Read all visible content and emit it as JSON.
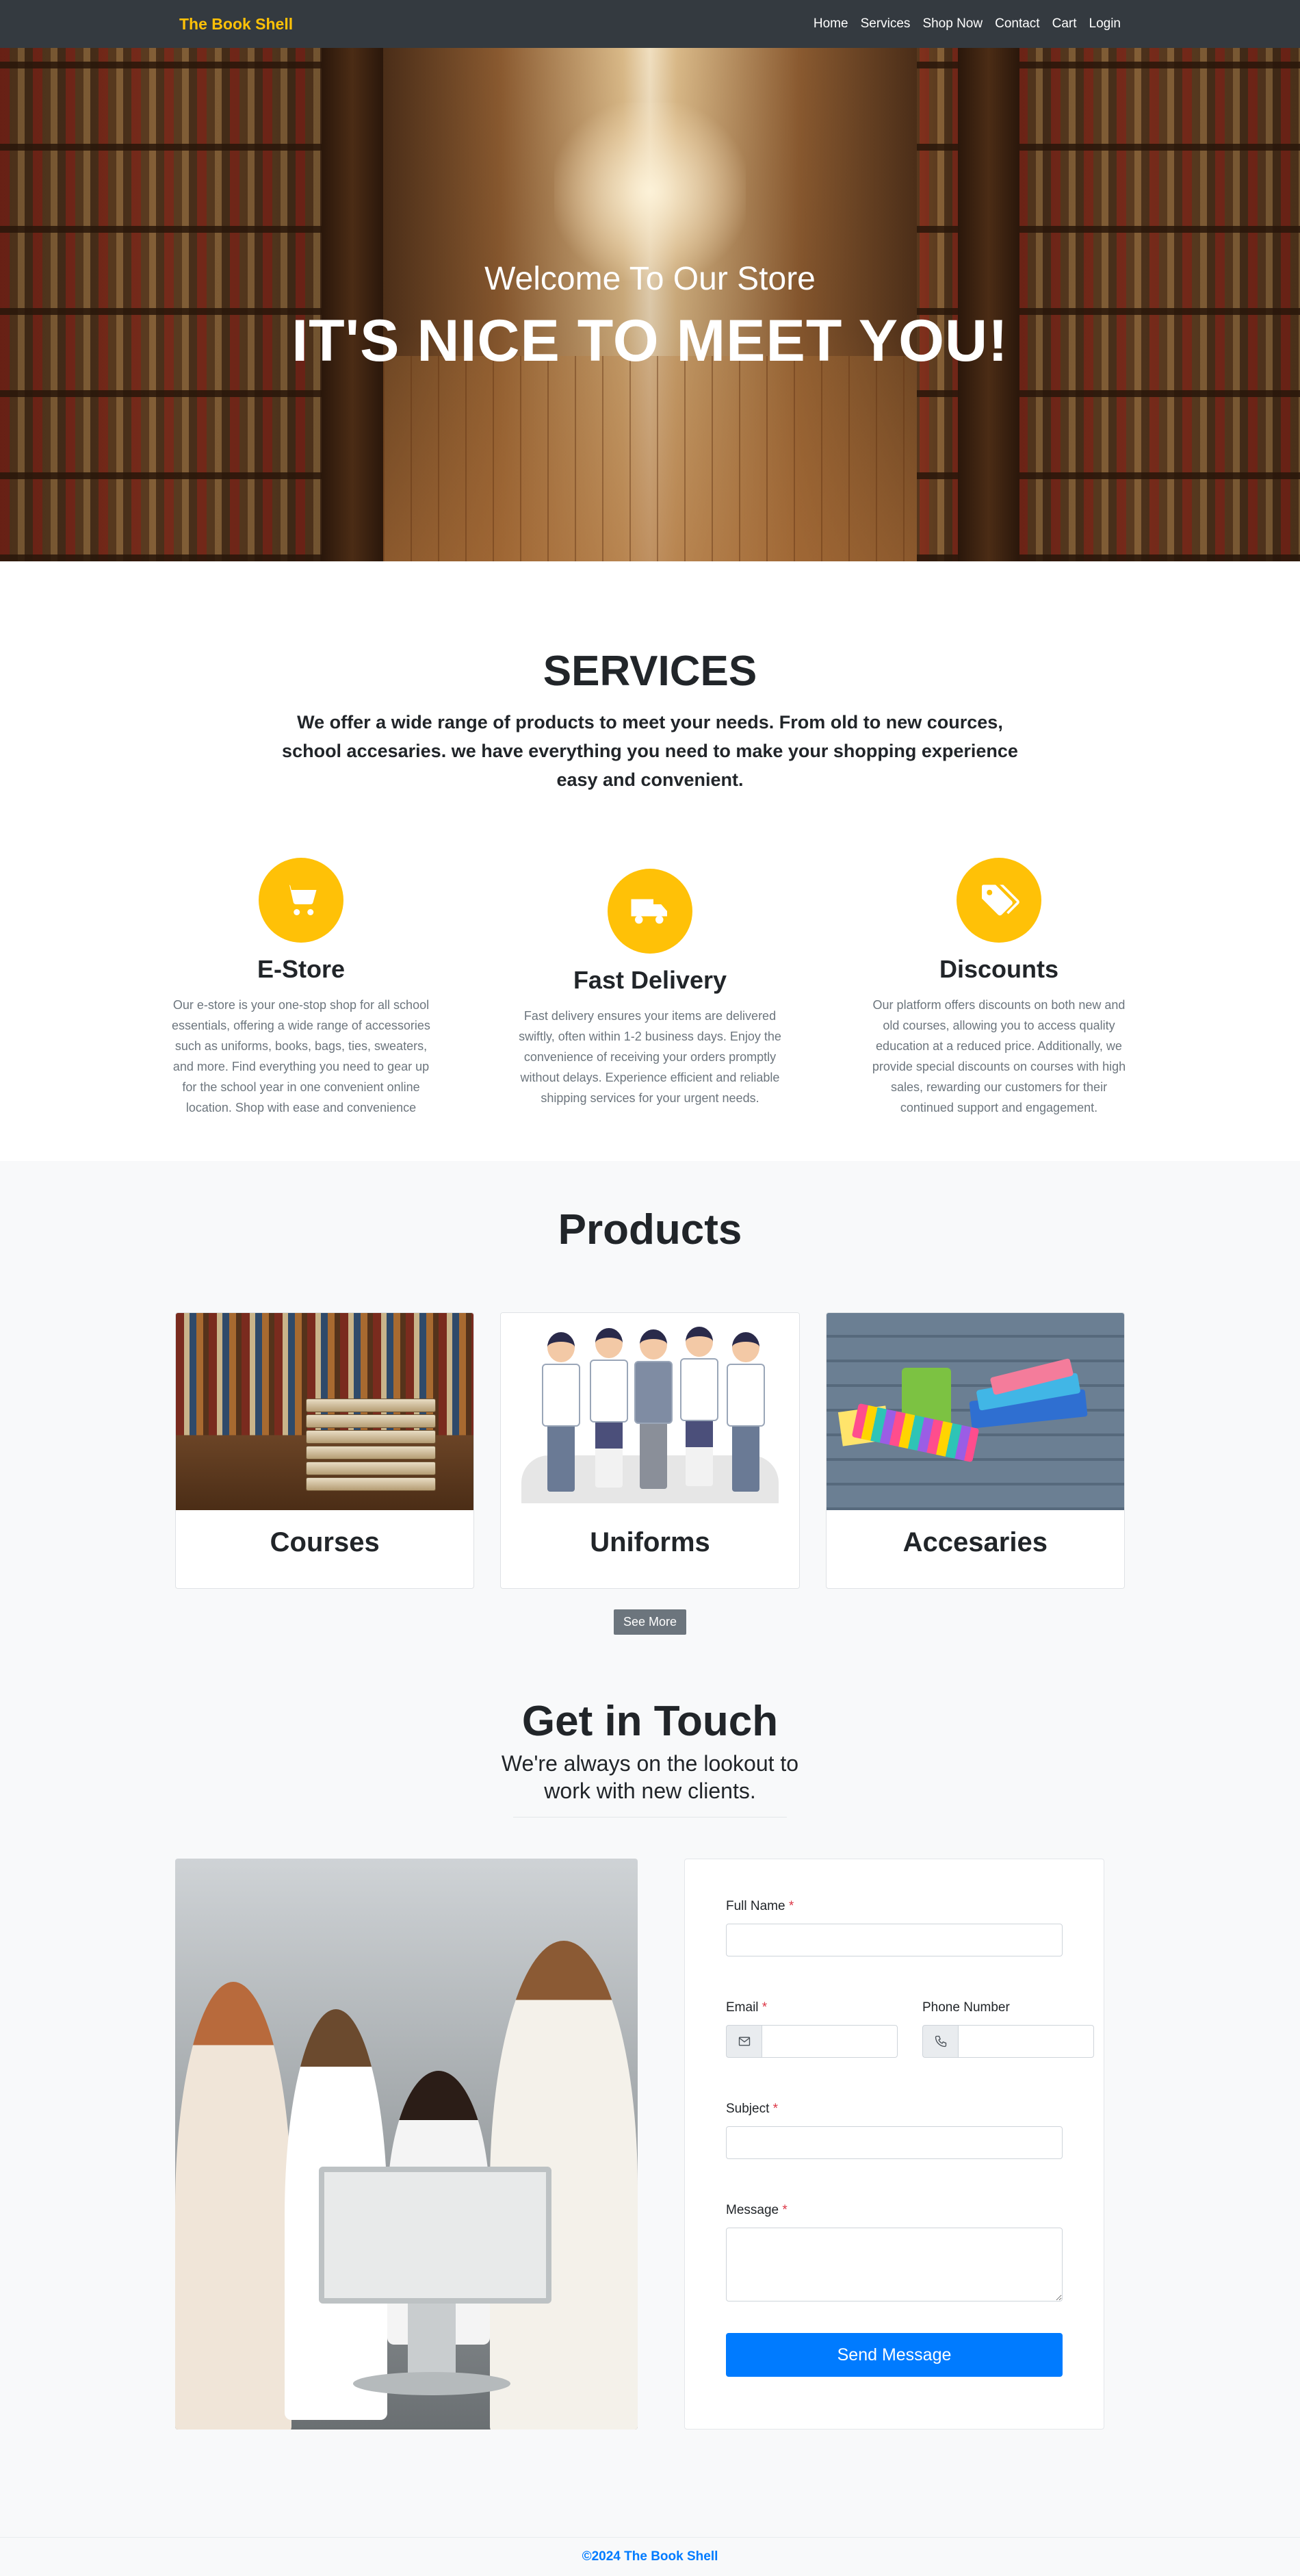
{
  "nav": {
    "brand": "The Book Shell",
    "links": [
      "Home",
      "Services",
      "Shop Now",
      "Contact",
      "Cart",
      "Login"
    ]
  },
  "hero": {
    "subtitle": "Welcome To Our Store",
    "title": "IT'S NICE TO MEET YOU!"
  },
  "services": {
    "title": "SERVICES",
    "description": "We offer a wide range of products to meet your needs. From old to new cources, school accesaries. we have everything you need to make your shopping experience easy and convenient.",
    "items": [
      {
        "icon": "shopping-cart-icon",
        "title": "E-Store",
        "text": "Our e-store is your one-stop shop for all school essentials, offering a wide range of accessories such as uniforms, books, bags, ties, sweaters, and more. Find everything you need to gear up for the school year in one convenient online location. Shop with ease and convenience"
      },
      {
        "icon": "delivery-truck-icon",
        "title": "Fast Delivery",
        "text": "Fast delivery ensures your items are delivered swiftly, often within 1-2 business days. Enjoy the convenience of receiving your orders promptly without delays. Experience efficient and reliable shipping services for your urgent needs."
      },
      {
        "icon": "price-tags-icon",
        "title": "Discounts",
        "text": "Our platform offers discounts on both new and old courses, allowing you to access quality education at a reduced price. Additionally, we provide special discounts on courses with high sales, rewarding our customers for their continued support and engagement."
      }
    ],
    "accent_color": "#ffc107"
  },
  "products": {
    "title": "Products",
    "items": [
      {
        "label": "Courses"
      },
      {
        "label": "Uniforms"
      },
      {
        "label": "Accesaries"
      }
    ],
    "see_more_label": "See More"
  },
  "contact": {
    "title": "Get in Touch",
    "subtitle_line1": "We're always on the lookout to",
    "subtitle_line2": "work with new clients.",
    "form": {
      "full_name_label": "Full Name",
      "email_label": "Email",
      "phone_label": "Phone Number",
      "subject_label": "Subject",
      "message_label": "Message",
      "required_mark": "*",
      "full_name_value": "",
      "email_value": "",
      "phone_value": "",
      "subject_value": "",
      "message_value": "",
      "send_label": "Send Message"
    }
  },
  "footer": {
    "text": "©2024 The Book Shell"
  },
  "colors": {
    "navbar": "#343a40",
    "brand": "#ffc107",
    "primary": "#007bff",
    "secondary": "#6c757d",
    "required": "#dc3545"
  }
}
